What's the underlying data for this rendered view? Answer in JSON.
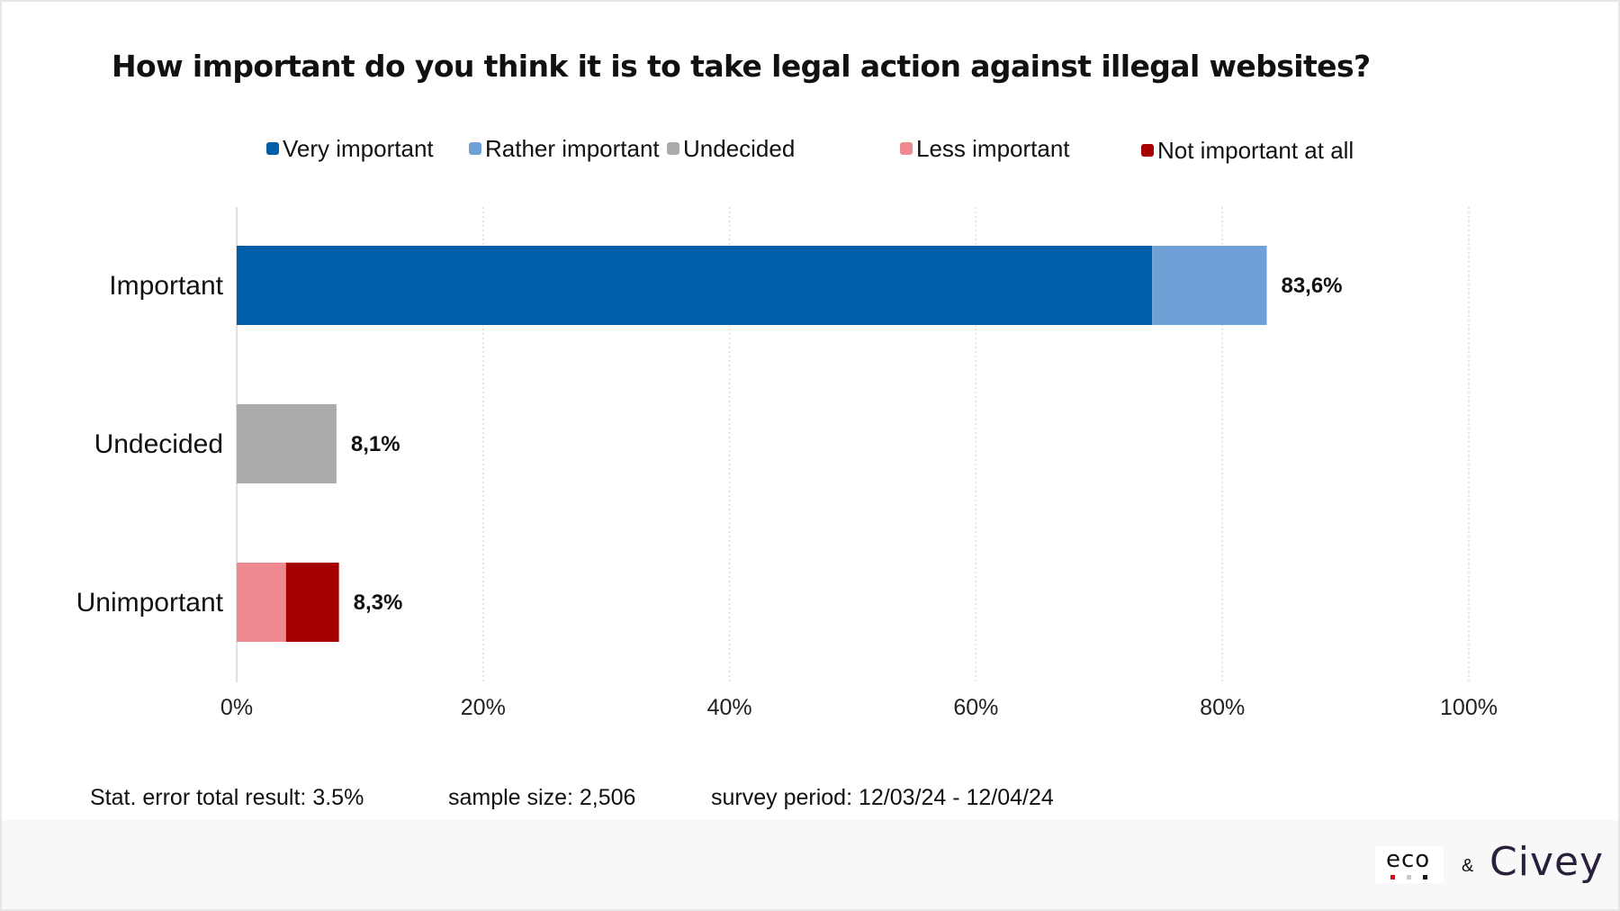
{
  "chart_data": {
    "type": "bar",
    "orientation": "horizontal",
    "stacked": true,
    "title": "How important do you think it is to take legal action against illegal websites?",
    "categories": [
      "Important",
      "Undecided",
      "Unimportant"
    ],
    "series": [
      {
        "name": "Very important",
        "color": "#005ea8",
        "values": [
          74.3,
          0,
          0
        ]
      },
      {
        "name": "Rather important",
        "color": "#6fa1d6",
        "values": [
          9.3,
          0,
          0
        ]
      },
      {
        "name": "Undecided",
        "color": "#ababab",
        "values": [
          0,
          8.1,
          0
        ]
      },
      {
        "name": "Less important",
        "color": "#f08a91",
        "values": [
          0,
          0,
          4.0
        ]
      },
      {
        "name": "Not important at all",
        "color": "#a60000",
        "values": [
          0,
          0,
          4.3
        ]
      }
    ],
    "totals": [
      83.6,
      8.1,
      8.3
    ],
    "total_labels": [
      "83,6%",
      "8,1%",
      "8,3%"
    ],
    "xlabel": "",
    "ylabel": "",
    "xlim": [
      0,
      100
    ],
    "x_ticks": [
      0,
      20,
      40,
      60,
      80,
      100
    ],
    "x_tick_labels": [
      "0%",
      "20%",
      "40%",
      "60%",
      "80%",
      "100%"
    ],
    "grid": "vertical dotted",
    "legend_position": "top"
  },
  "footnotes": {
    "stat_error": "Stat. error total result: 3.5%",
    "sample_size": "sample size: 2,506",
    "survey_period": "survey period: 12/03/24 - 12/04/24"
  },
  "branding": {
    "eco": "eco",
    "ampersand": "&",
    "civey": "Civey",
    "eco_dot_colors": [
      "#e30613",
      "#c8c8c8",
      "#1a1a1a"
    ]
  }
}
